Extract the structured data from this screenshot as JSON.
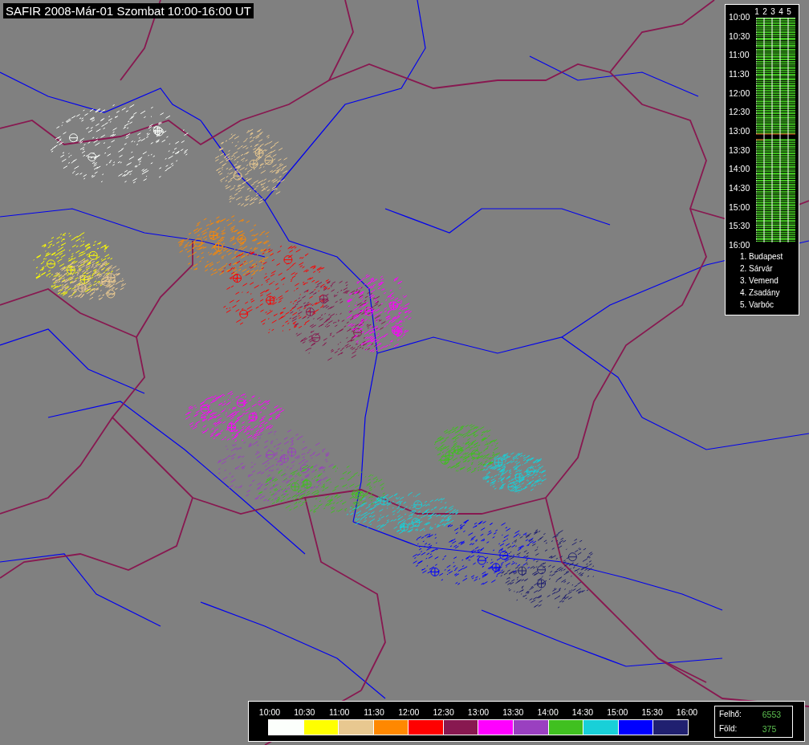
{
  "title": "SAFIR 2008-Már-01 Szombat 10:00-16:00 UT",
  "station_panel": {
    "columns": [
      "1",
      "2",
      "3",
      "4",
      "5"
    ],
    "times": [
      "10:00",
      "10:30",
      "11:00",
      "11:30",
      "12:00",
      "12:30",
      "13:00",
      "13:30",
      "14:00",
      "14:30",
      "15:00",
      "15:30",
      "16:00"
    ],
    "stations": [
      "1. Budapest",
      "2. Sárvár",
      "3. Vemend",
      "4. Zsadány",
      "5. Varbóc"
    ]
  },
  "legend": {
    "times": [
      "10:00",
      "10:30",
      "11:00",
      "11:30",
      "12:00",
      "12:30",
      "13:00",
      "13:30",
      "14:00",
      "14:30",
      "15:00",
      "15:30",
      "16:00"
    ],
    "intervals": [
      {
        "color": "#fcfffc"
      },
      {
        "color": "#ffff00"
      },
      {
        "color": "#e8c890"
      },
      {
        "color": "#ff8800"
      },
      {
        "color": "#ff0000"
      },
      {
        "color": "#881850"
      },
      {
        "color": "#ff00ff"
      },
      {
        "color": "#9a40c0"
      },
      {
        "color": "#40c020"
      },
      {
        "color": "#18d0d8"
      },
      {
        "color": "#0000ff"
      },
      {
        "color": "#202070"
      }
    ]
  },
  "counts": [
    {
      "label": "Felhő:",
      "value": "6553"
    },
    {
      "label": "Föld:",
      "value": "375"
    }
  ]
}
